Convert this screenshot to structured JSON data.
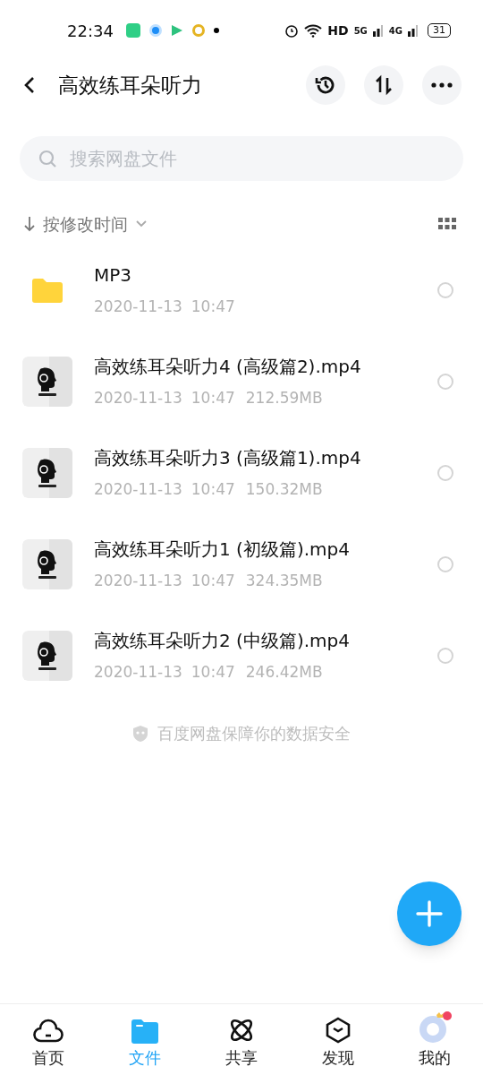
{
  "status_bar": {
    "time": "22:34",
    "network": "HD",
    "signal_1": "5G",
    "signal_2": "4G",
    "battery": "31"
  },
  "header": {
    "title": "高效练耳朵听力"
  },
  "search": {
    "placeholder": "搜索网盘文件"
  },
  "sort": {
    "label": "按修改时间"
  },
  "files": [
    {
      "kind": "folder",
      "name": "MP3",
      "date": "2020-11-13",
      "time": "10:47",
      "selected": false
    },
    {
      "kind": "video",
      "name": "高效练耳朵听力4 (高级篇2).mp4",
      "date": "2020-11-13",
      "time": "10:47",
      "size": "212.59MB",
      "selected": false
    },
    {
      "kind": "video",
      "name": "高效练耳朵听力3 (高级篇1).mp4",
      "date": "2020-11-13",
      "time": "10:47",
      "size": "150.32MB",
      "selected": false
    },
    {
      "kind": "video",
      "name": "高效练耳朵听力1 (初级篇).mp4",
      "date": "2020-11-13",
      "time": "10:47",
      "size": "324.35MB",
      "selected": false
    },
    {
      "kind": "video",
      "name": "高效练耳朵听力2 (中级篇).mp4",
      "date": "2020-11-13",
      "time": "10:47",
      "size": "246.42MB",
      "selected": false
    }
  ],
  "footer_note": "百度网盘保障你的数据安全",
  "tabs": [
    {
      "kind": "home",
      "label": "首页",
      "selected": false
    },
    {
      "kind": "files",
      "label": "文件",
      "selected": true
    },
    {
      "kind": "share",
      "label": "共享",
      "selected": false
    },
    {
      "kind": "discover",
      "label": "发现",
      "selected": false
    },
    {
      "kind": "me",
      "label": "我的",
      "selected": false
    }
  ]
}
